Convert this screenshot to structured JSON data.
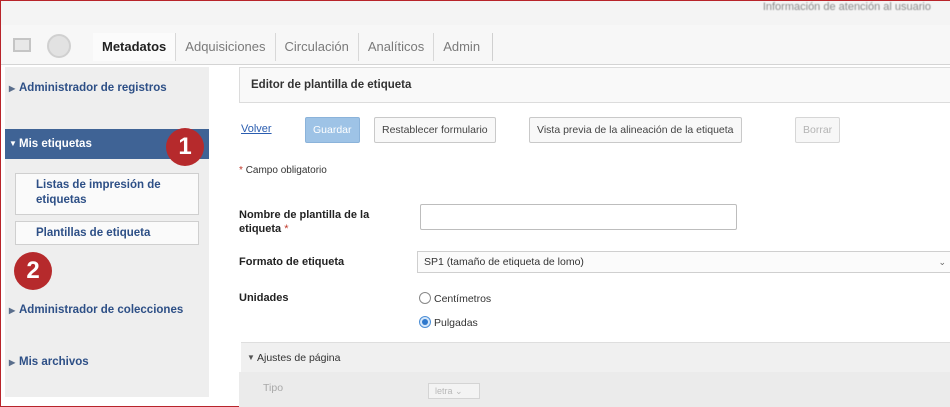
{
  "topbar": {
    "notice": "Información de atención al usuario"
  },
  "tabs": [
    {
      "label": "Metadatos",
      "active": true
    },
    {
      "label": "Adquisiciones"
    },
    {
      "label": "Circulación"
    },
    {
      "label": "Analíticos"
    },
    {
      "label": "Admin"
    }
  ],
  "sidebar": {
    "records_admin": "Administrador de registros",
    "my_labels": "Mis etiquetas",
    "print_lists": "Listas de impresión de etiquetas",
    "templates": "Plantillas de etiqueta",
    "collections_admin": "Administrador de colecciones",
    "my_files": "Mis archivos"
  },
  "badges": [
    "1",
    "2"
  ],
  "editor": {
    "title": "Editor de plantilla de etiqueta",
    "back": "Volver",
    "save": "Guardar",
    "reset": "Restablecer formulario",
    "preview": "Vista previa de la alineación de la etiqueta",
    "delete": "Borrar",
    "required_note": "Campo obligatorio",
    "name_label": "Nombre de plantilla de la etiqueta",
    "name_value": "",
    "format_label": "Formato de etiqueta",
    "format_value": "SP1 (tamaño de etiqueta de lomo)",
    "units_label": "Unidades",
    "unit_cm": "Centímetros",
    "unit_in": "Pulgadas",
    "unit_selected": "Pulgadas",
    "page_settings": "Ajustes de página",
    "type_label": "Tipo",
    "type_value": "letra"
  },
  "colors": {
    "accent": "#3f6395",
    "badge": "#b62a2c",
    "primary_button": "#9ec3e6"
  }
}
